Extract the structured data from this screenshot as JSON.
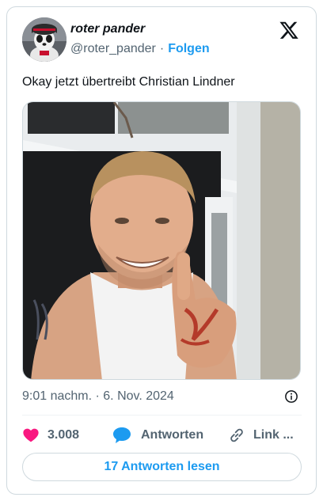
{
  "tweet": {
    "author_name": "roter pander",
    "author_handle": "@roter_pander",
    "separator": "·",
    "follow_label": "Folgen",
    "text": "Okay jetzt übertreibt Christian Lindner",
    "timestamp": "9:01 nachm. · 6. Nov. 2024"
  },
  "actions": {
    "like_count": "3.008",
    "reply_label": "Antworten",
    "link_label": "Link ..."
  },
  "read_replies_label": "17 Antworten lesen",
  "colors": {
    "accent": "#1d9bf0",
    "like": "#f91880",
    "text_primary": "#0f1419",
    "text_secondary": "#536471",
    "border": "#cfd9de"
  },
  "icons": {
    "brand": "x-logo-icon",
    "info": "info-icon",
    "like": "heart-icon",
    "reply": "speech-bubble-icon",
    "link": "link-icon"
  }
}
